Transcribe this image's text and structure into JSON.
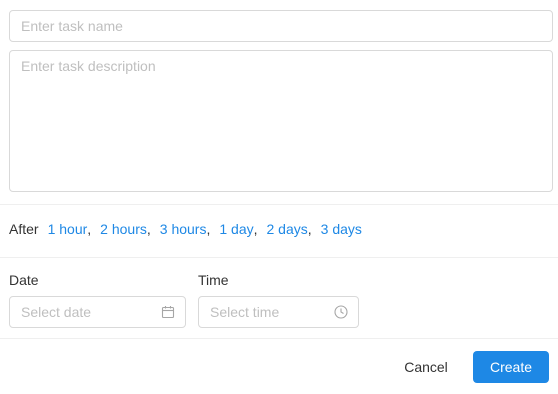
{
  "form": {
    "task_name": {
      "placeholder": "Enter task name",
      "value": ""
    },
    "task_description": {
      "placeholder": "Enter task description",
      "value": ""
    }
  },
  "quick_times": {
    "label": "After",
    "separator": ",",
    "options": [
      "1 hour",
      "2 hours",
      "3 hours",
      "1 day",
      "2 days",
      "3 days"
    ]
  },
  "date_field": {
    "label": "Date",
    "placeholder": "Select date",
    "icon": "calendar-icon"
  },
  "time_field": {
    "label": "Time",
    "placeholder": "Select time",
    "icon": "clock-icon"
  },
  "actions": {
    "cancel_label": "Cancel",
    "create_label": "Create"
  },
  "colors": {
    "accent": "#1e88e5",
    "border": "#d9d9d9",
    "placeholder": "#bfbfbf",
    "text": "#333333"
  }
}
